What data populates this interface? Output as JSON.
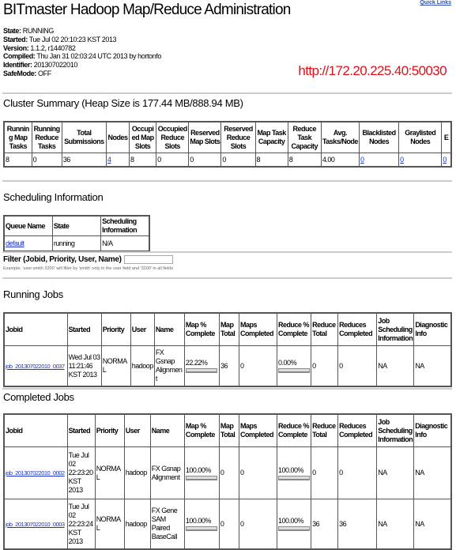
{
  "title": "BITmaster Hadoop Map/Reduce Administration",
  "quick_links": "Quick Links",
  "info": [
    {
      "label": "State:",
      "value": "RUNNING"
    },
    {
      "label": "Started:",
      "value": "Tue Jul 02 20:10:23 KST 2013"
    },
    {
      "label": "Version:",
      "value": "1.1.2, r1440782"
    },
    {
      "label": "Compiled:",
      "value": "Thu Jan 31 02:03:24 UTC 2013 by hortonfo"
    },
    {
      "label": "Identifier:",
      "value": "201307022010"
    },
    {
      "label": "SafeMode:",
      "value": "OFF"
    }
  ],
  "url_annotation": "http://172.20.225.40:50030",
  "cluster": {
    "heading": "Cluster Summary (Heap Size is 177.44 MB/888.94 MB)",
    "headers": [
      "Running Map Tasks",
      "Running Reduce Tasks",
      "Total Submissions",
      "Nodes",
      "Occupied Map Slots",
      "Occupied Reduce Slots",
      "Reserved Map Slots",
      "Reserved Reduce Slots",
      "Map Task Capacity",
      "Reduce Task Capacity",
      "Avg. Tasks/Node",
      "Blacklisted Nodes",
      "Graylisted Nodes",
      "E"
    ],
    "values": [
      "8",
      "0",
      "36",
      "4",
      "8",
      "0",
      "0",
      "0",
      "8",
      "8",
      "4.00",
      "0",
      "0",
      "0"
    ],
    "links": [
      3,
      11,
      12,
      13
    ]
  },
  "scheduling": {
    "heading": "Scheduling Information",
    "headers": [
      "Queue Name",
      "State",
      "Scheduling Information"
    ],
    "row": [
      "default",
      "running",
      "N/A"
    ]
  },
  "filter": {
    "label": "Filter (Jobid, Priority, User, Name)",
    "value": "",
    "example": "Example: 'user:smith 3200' will filter by 'smith' only in the user field and '3200' in all fields"
  },
  "job_headers": [
    "Jobid",
    "Started",
    "Priority",
    "User",
    "Name",
    "Map % Complete",
    "Map Total",
    "Maps Completed",
    "Reduce % Complete",
    "Reduce Total",
    "Reduces Completed",
    "Job Scheduling Information",
    "Diagnostic Info"
  ],
  "running": {
    "heading": "Running Jobs",
    "rows": [
      [
        "job_201307022010_0037",
        "Wed Jul 03 11:21:46 KST 2013",
        "NORMAL",
        "hadoop",
        "FX Gsnap Alignment",
        "22.22%",
        "36",
        "0",
        "0.00%",
        "0",
        "0",
        "NA",
        "NA"
      ]
    ]
  },
  "completed": {
    "heading": "Completed Jobs",
    "rows": [
      [
        "job_201307022010_0002",
        "Tue Jul 02 22:23:20 KST 2013",
        "NORMAL",
        "hadoop",
        "FX Gsnap Alignment",
        "100.00%",
        "0",
        "0",
        "100.00%",
        "0",
        "0",
        "NA",
        "NA"
      ],
      [
        "job_201307022010_0003",
        "Tue Jul 02 22:23:24 KST 2013",
        "NORMAL",
        "hadoop",
        "FX Gene SAM Paired BaseCall",
        "100.00%",
        "0",
        "0",
        "100.00%",
        "36",
        "36",
        "NA",
        "NA"
      ]
    ]
  },
  "colors": {
    "url_annotation": "#e0101a",
    "link": "#1a33cc"
  }
}
